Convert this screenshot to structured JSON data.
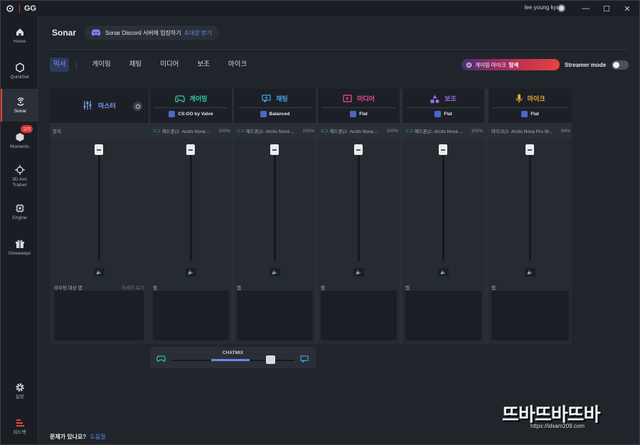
{
  "titlebar": {
    "brand": "GG",
    "user": "lee young kyu",
    "minimize": "—",
    "maximize": "☐",
    "close": "✕"
  },
  "sidebar": {
    "items": [
      {
        "label": "Home",
        "icon": "home-icon"
      },
      {
        "label": "QuickSet",
        "icon": "quickset-icon"
      },
      {
        "label": "Sonar",
        "icon": "sonar-icon"
      },
      {
        "label": "Moments",
        "icon": "moments-icon",
        "badge": "고기"
      },
      {
        "label": "3D Aim Trainer",
        "icon": "aim-icon"
      },
      {
        "label": "Engine",
        "icon": "chip-icon"
      },
      {
        "label": "Giveaways",
        "icon": "gift-icon"
      },
      {
        "label": "설정",
        "icon": "gear-icon"
      },
      {
        "label": "피드백",
        "icon": "feedback-icon"
      }
    ]
  },
  "header": {
    "title": "Sonar",
    "discord_text": "Sonar Discord 서버에 입장하기",
    "discord_invite": "초대장 받기"
  },
  "tabs": [
    "믹서",
    "게이밍",
    "채팅",
    "미디어",
    "보조",
    "마이크"
  ],
  "scan_button": {
    "prefix": "게이밍 마이크",
    "label": "탐색"
  },
  "streamer_label": "Streamer mode",
  "mixer": {
    "master": {
      "name": "마스터",
      "device_label": "장치",
      "apps_label": "라우팅 대상 앱",
      "detail_link": "자세히 보기"
    },
    "channels": [
      {
        "name": "게이밍",
        "preset": "CS:GO by Valve",
        "device": "헤드폰(2- Arctis Nova ...",
        "pct": "100%",
        "color": "#2fd6a2",
        "apps_label": "앱"
      },
      {
        "name": "채팅",
        "preset": "Balanced",
        "device": "헤드폰(2- Arctis Nova ...",
        "pct": "100%",
        "color": "#3fa9ea",
        "apps_label": "앱"
      },
      {
        "name": "미디어",
        "preset": "Flat",
        "device": "헤드폰(2- Arctis Nova ...",
        "pct": "100%",
        "color": "#ee4f8e",
        "apps_label": "앱"
      },
      {
        "name": "보조",
        "preset": "Flat",
        "device": "헤드폰(2- Arctis Nova ...",
        "pct": "100%",
        "color": "#9b6bf0",
        "apps_label": "앱"
      },
      {
        "name": "마이크",
        "preset": "Flat",
        "device": "마이크(2- Arctis Nova Pro W...",
        "pct": "94%",
        "color": "#f0a531",
        "apps_label": "앱"
      }
    ]
  },
  "chatmix": {
    "label": "CHATMIX"
  },
  "help": {
    "question": "문제가 있나요?",
    "link": "도움말"
  },
  "watermark": {
    "title": "뜨바뜨바뜨바",
    "url": "https://idsam209.com"
  }
}
